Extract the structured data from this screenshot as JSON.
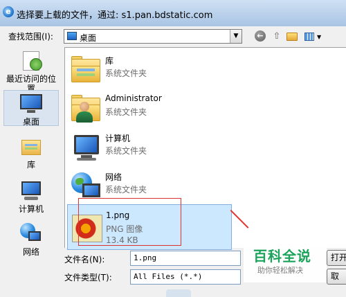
{
  "window": {
    "title": "选择要上载的文件，通过: s1.pan.bdstatic.com",
    "icon": "ie-icon"
  },
  "toolbar": {
    "look_in_label": "查找范围(I):",
    "look_in_value": "桌面",
    "back_icon": "back-arrow-icon",
    "up_icon": "up-folder-icon",
    "new_folder_icon": "new-folder-icon",
    "view_icon": "view-menu-icon"
  },
  "places": [
    {
      "label": "最近访问的位置",
      "icon": "recent-places-icon"
    },
    {
      "label": "桌面",
      "icon": "desktop-icon",
      "selected": true
    },
    {
      "label": "库",
      "icon": "libraries-icon"
    },
    {
      "label": "计算机",
      "icon": "computer-icon"
    },
    {
      "label": "网络",
      "icon": "network-icon"
    }
  ],
  "files": [
    {
      "name": "库",
      "type": "系统文件夹",
      "icon": "libraries-folder-icon"
    },
    {
      "name": "Administrator",
      "type": "系统文件夹",
      "icon": "user-folder-icon"
    },
    {
      "name": "计算机",
      "type": "系统文件夹",
      "icon": "computer-icon"
    },
    {
      "name": "网络",
      "type": "系统文件夹",
      "icon": "network-icon"
    },
    {
      "name": "1.png",
      "type": "PNG 图像",
      "size": "13.4 KB",
      "icon": "png-thumbnail-icon",
      "selected": true
    }
  ],
  "bottom": {
    "filename_label": "文件名(N):",
    "filename_value": "1.png",
    "filetype_label": "文件类型(T):",
    "filetype_value": "All Files (*.*)",
    "open_button": "打开",
    "cancel_button": "取"
  },
  "watermark": {
    "title": "百科全说",
    "subtitle": "助你轻松解决"
  },
  "colors": {
    "selection": "#cce8ff",
    "annotation": "#e03131",
    "watermark": "#1aa35a"
  }
}
